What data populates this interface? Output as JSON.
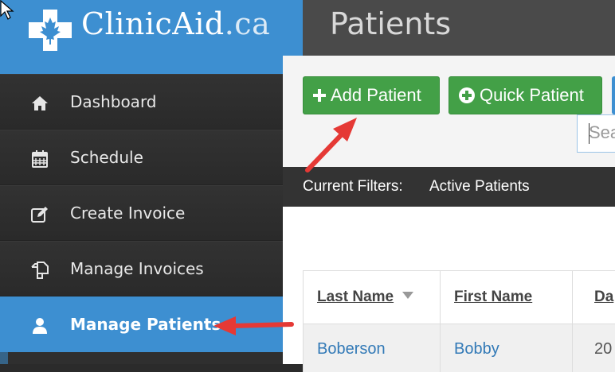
{
  "brand": {
    "name": "ClinicAid",
    "tld": ".ca"
  },
  "header": {
    "title": "Patients"
  },
  "sidebar": {
    "items": [
      {
        "label": "Dashboard",
        "icon": "home-icon"
      },
      {
        "label": "Schedule",
        "icon": "calendar-icon"
      },
      {
        "label": "Create Invoice",
        "icon": "edit-icon"
      },
      {
        "label": "Manage Invoices",
        "icon": "copy-icon"
      },
      {
        "label": "Manage Patients",
        "icon": "user-icon",
        "active": true
      }
    ]
  },
  "toolbar": {
    "add_patient": "Add Patient",
    "quick_patient": "Quick Patient",
    "search_placeholder": "Sea"
  },
  "filters": {
    "label": "Current Filters:",
    "value": "Active Patients"
  },
  "table": {
    "columns": [
      "Last Name",
      "First Name",
      "Da"
    ],
    "rows": [
      [
        "Boberson",
        "Bobby",
        "20"
      ]
    ]
  },
  "colors": {
    "accent_blue": "#3d8fd1",
    "button_green": "#43a047",
    "annotation_red": "#e53935"
  }
}
